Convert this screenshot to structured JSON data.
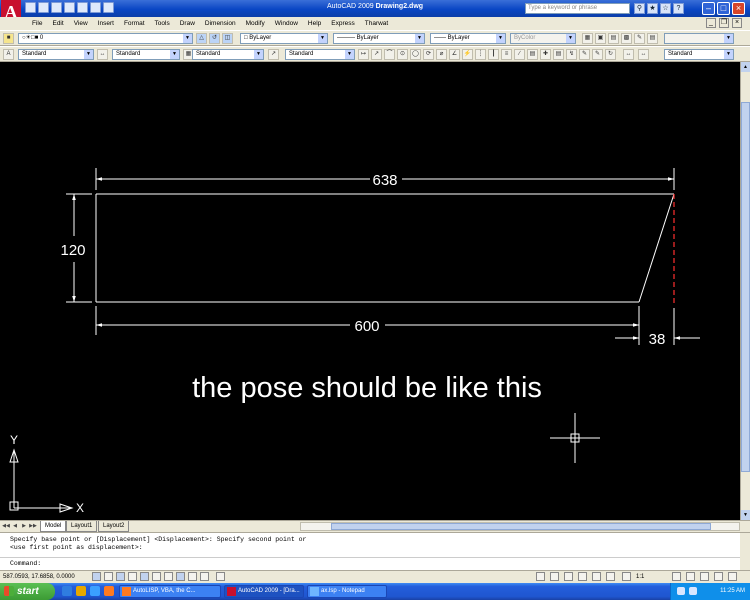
{
  "window": {
    "app_name": "AutoCAD 2009",
    "document_name": "Drawing2.dwg",
    "search_placeholder": "Type a keyword or phrase"
  },
  "menu": [
    "File",
    "Edit",
    "View",
    "Insert",
    "Format",
    "Tools",
    "Draw",
    "Dimension",
    "Modify",
    "Window",
    "Help",
    "Express",
    "Tharwat"
  ],
  "toolbar_row1": {
    "layer_value": "0",
    "color_value": "ByLayer",
    "linetype_value": "ByLayer",
    "lineweight_value": "ByLayer",
    "plotstyle_value": "ByColor"
  },
  "toolbar_row2": {
    "text_style": "Standard",
    "dim_style": "Standard",
    "table_style": "Standard",
    "mleader_style": "Standard",
    "dim_style_right": "Standard"
  },
  "drawing": {
    "dim_top": "638",
    "dim_left": "120",
    "dim_bottom": "600",
    "dim_right": "38",
    "annotation": "the pose should be like this",
    "ucs_y": "Y",
    "ucs_x": "X"
  },
  "layout_tabs": [
    "Model",
    "Layout1",
    "Layout2"
  ],
  "command": {
    "line1": "Specify base point or [Displacement] <Displacement>: Specify second point or",
    "line2": "<use first point as displacement>:",
    "prompt": "Command:"
  },
  "status": {
    "coordinates": "587.0593, 17.6858, 0.0000",
    "annotation_scale": "1:1"
  },
  "taskbar": {
    "start_label": "start",
    "tasks": [
      "AutoLISP, VBA, the C...",
      "AutoCAD 2009 - [Dra...",
      "ax.lsp - Notepad"
    ],
    "clock": "11:25 AM"
  },
  "colors": {
    "canvas": "#000000",
    "geometry": "#ffffff",
    "hidden_line": "#ff3030",
    "titlebar": "#0a46c4"
  }
}
